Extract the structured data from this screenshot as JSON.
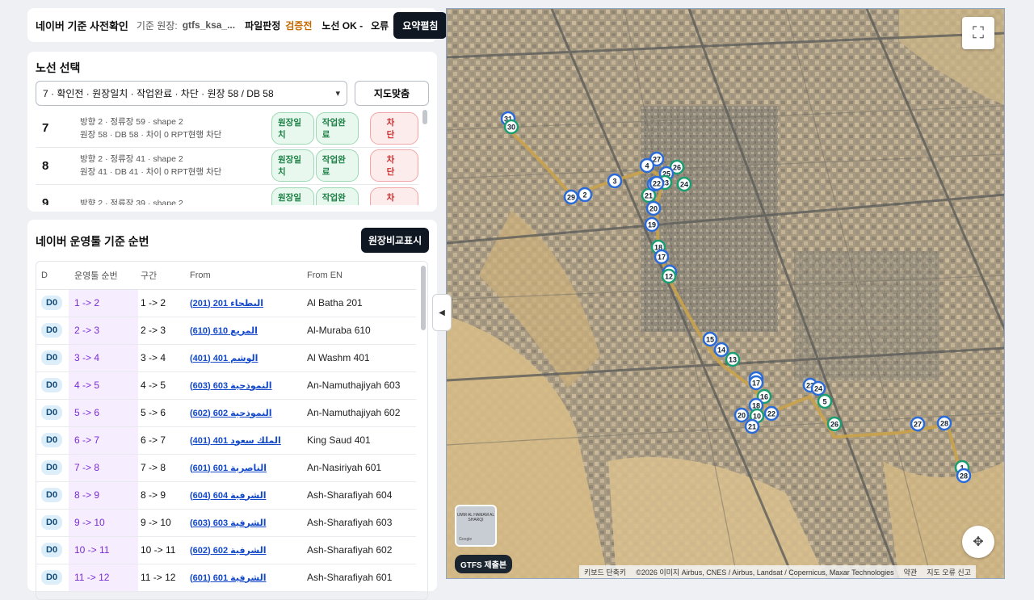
{
  "header": {
    "title": "네이버 기준 사전확인",
    "base_label": "기준 원장:",
    "base_value": "gtfs_ksa_...",
    "file_label": "파일판정",
    "file_value": "검증전",
    "route_status": "노선 OK -",
    "error_label": "오류",
    "summary_button": "요약펼침"
  },
  "route_select": {
    "title": "노선 선택",
    "selected": "7 · 확인전 · 원장일치 · 작업완료 · 차단 · 원장 58 / DB 58",
    "fit_button": "지도맞춤",
    "items": [
      {
        "num": "7",
        "line1": "방향 2 · 정류장 59 · shape 2",
        "line2": "원장 58 · DB 58 · 차이 0 RPT현행 차단",
        "tag1": "원장일치",
        "tag2": "작업완료",
        "tag3": "차단"
      },
      {
        "num": "8",
        "line1": "방향 2 · 정류장 41 · shape 2",
        "line2": "원장 41 · DB 41 · 차이 0 RPT현행 차단",
        "tag1": "원장일치",
        "tag2": "작업완료",
        "tag3": "차단"
      },
      {
        "num": "9",
        "line1": "방향 2 · 정류장 39 · shape 2",
        "line2": "",
        "tag1": "원장일치",
        "tag2": "작업완료",
        "tag3": "차단"
      }
    ]
  },
  "sequence": {
    "title": "네이버 운영툴 기준 순번",
    "compare_button": "원장비교표시",
    "columns": {
      "d": "D",
      "seq": "운영툴 순번",
      "seg": "구간",
      "from": "From",
      "from_en": "From EN"
    },
    "rows": [
      {
        "d": "D0",
        "seq": "1 -> 2",
        "seg": "1 -> 2",
        "from": "البطحاء 201 (201)",
        "from_en": "Al Batha 201"
      },
      {
        "d": "D0",
        "seq": "2 -> 3",
        "seg": "2 -> 3",
        "from": "المربع 610 (610)",
        "from_en": "Al-Muraba 610"
      },
      {
        "d": "D0",
        "seq": "3 -> 4",
        "seg": "3 -> 4",
        "from": "الوشم 401 (401)",
        "from_en": "Al Washm 401"
      },
      {
        "d": "D0",
        "seq": "4 -> 5",
        "seg": "4 -> 5",
        "from": "النموذجية 603 (603)",
        "from_en": "An-Namuthajiyah 603"
      },
      {
        "d": "D0",
        "seq": "5 -> 6",
        "seg": "5 -> 6",
        "from": "النموذجية 602 (602)",
        "from_en": "An-Namuthajiyah 602"
      },
      {
        "d": "D0",
        "seq": "6 -> 7",
        "seg": "6 -> 7",
        "from": "الملك سعود 401 (401)",
        "from_en": "King Saud 401"
      },
      {
        "d": "D0",
        "seq": "7 -> 8",
        "seg": "7 -> 8",
        "from": "الناصرية 601 (601)",
        "from_en": "An-Nasiriyah 601"
      },
      {
        "d": "D0",
        "seq": "8 -> 9",
        "seg": "8 -> 9",
        "from": "الشرفية 604 (604)",
        "from_en": "Ash-Sharafiyah 604"
      },
      {
        "d": "D0",
        "seq": "9 -> 10",
        "seg": "9 -> 10",
        "from": "الشرفية 603 (603)",
        "from_en": "Ash-Sharafiyah 603"
      },
      {
        "d": "D0",
        "seq": "10 -> 11",
        "seg": "10 -> 11",
        "from": "الشرفية 602 (602)",
        "from_en": "Ash-Sharafiyah 602"
      },
      {
        "d": "D0",
        "seq": "11 -> 12",
        "seg": "11 -> 12",
        "from": "الشرفية 601 (601)",
        "from_en": "Ash-Sharafiyah 601"
      }
    ]
  },
  "map": {
    "minimap_label": "UMM AL HAMAM AL SHARQI",
    "minimap_brand": "Google",
    "gtfs_badge": "GTFS 제출본",
    "attribution": {
      "shortcuts": "키보드 단축키",
      "copyright": "©2026 이미지 Airbus, CNES / Airbus, Landsat / Copernicus, Maxar Technologies",
      "terms": "약관",
      "report": "지도 오류 신고"
    },
    "markers": [
      "31",
      "30",
      "27",
      "4",
      "26",
      "25",
      "3",
      "23",
      "29",
      "2",
      "21",
      "6",
      "22",
      "24",
      "20",
      "19",
      "18",
      "17",
      "16",
      "12",
      "15",
      "14",
      "13",
      "12",
      "17",
      "16",
      "23",
      "24",
      "5",
      "22",
      "18",
      "10",
      "20",
      "21",
      "26",
      "27",
      "28",
      "1",
      "28"
    ]
  }
}
